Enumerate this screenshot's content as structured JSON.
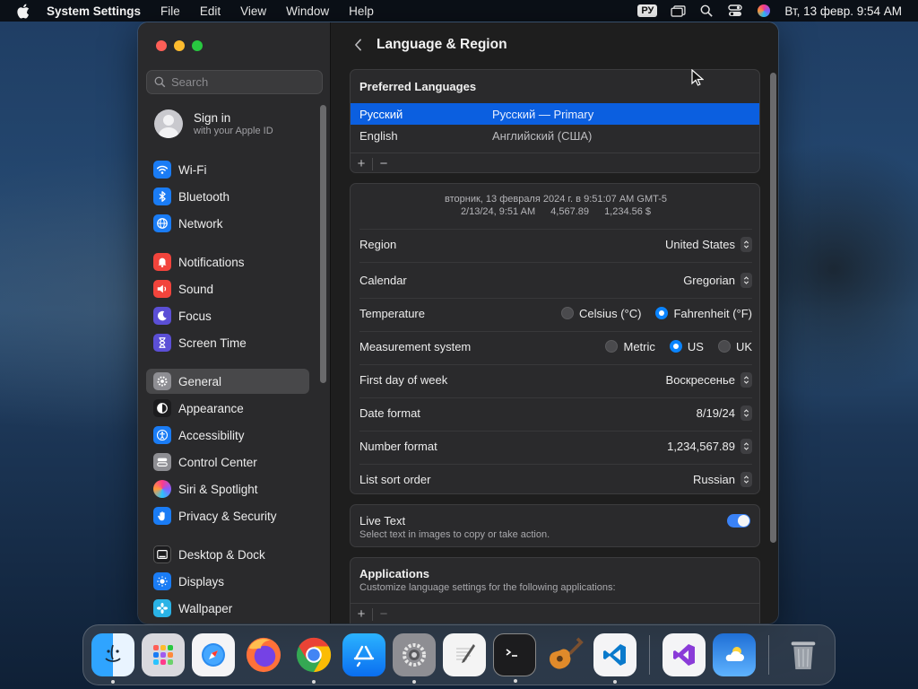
{
  "menubar": {
    "app_name": "System Settings",
    "menus": [
      "File",
      "Edit",
      "View",
      "Window",
      "Help"
    ],
    "input_lang": "РУ",
    "datetime": "Вт, 13 февр.  9:54 AM"
  },
  "sidebar": {
    "search_placeholder": "Search",
    "account": {
      "title": "Sign in",
      "subtitle": "with your Apple ID"
    },
    "items": [
      {
        "label": "Wi-Fi",
        "icon": "wifi-icon",
        "color": "#1a7cf5"
      },
      {
        "label": "Bluetooth",
        "icon": "bluetooth-icon",
        "color": "#1a7cf5"
      },
      {
        "label": "Network",
        "icon": "globe-icon",
        "color": "#1a7cf5"
      },
      {
        "label": "Notifications",
        "icon": "bell-icon",
        "color": "#f2443c"
      },
      {
        "label": "Sound",
        "icon": "speaker-icon",
        "color": "#f2443c"
      },
      {
        "label": "Focus",
        "icon": "moon-icon",
        "color": "#5b4fd6"
      },
      {
        "label": "Screen Time",
        "icon": "hourglass-icon",
        "color": "#5b4fd6"
      },
      {
        "label": "General",
        "icon": "gear-icon",
        "color": "#8e8e93"
      },
      {
        "label": "Appearance",
        "icon": "appearance-icon",
        "color": "#1c1c1e"
      },
      {
        "label": "Accessibility",
        "icon": "accessibility-icon",
        "color": "#1a7cf5"
      },
      {
        "label": "Control Center",
        "icon": "control-center-icon",
        "color": "#8e8e93"
      },
      {
        "label": "Siri & Spotlight",
        "icon": "siri-icon",
        "color": "#7a4fd6"
      },
      {
        "label": "Privacy & Security",
        "icon": "hand-icon",
        "color": "#1a7cf5"
      },
      {
        "label": "Desktop & Dock",
        "icon": "dock-icon",
        "color": "#1c1c1e"
      },
      {
        "label": "Displays",
        "icon": "sun-icon",
        "color": "#1a7cf5"
      },
      {
        "label": "Wallpaper",
        "icon": "flower-icon",
        "color": "#2ab3e6"
      }
    ],
    "selected": "General"
  },
  "content": {
    "title": "Language & Region",
    "preferred_languages": {
      "title": "Preferred Languages",
      "rows": [
        {
          "name": "Русский",
          "detail": "Русский — Primary"
        },
        {
          "name": "English",
          "detail": "Английский (США)"
        }
      ]
    },
    "preview": {
      "line1": "вторник, 13 февраля 2024 г. в 9:51:07 AM GMT-5",
      "line2": [
        "2/13/24, 9:51 AM",
        "4,567.89",
        "1,234.56 $"
      ]
    },
    "settings": {
      "region": {
        "label": "Region",
        "value": "United States"
      },
      "calendar": {
        "label": "Calendar",
        "value": "Gregorian"
      },
      "temperature": {
        "label": "Temperature",
        "options": [
          "Celsius (°C)",
          "Fahrenheit (°F)"
        ]
      },
      "measurement": {
        "label": "Measurement system",
        "options": [
          "Metric",
          "US",
          "UK"
        ]
      },
      "first_day": {
        "label": "First day of week",
        "value": "Воскресенье"
      },
      "date_format": {
        "label": "Date format",
        "value": "8/19/24"
      },
      "number_format": {
        "label": "Number format",
        "value": "1,234,567.89"
      },
      "sort_order": {
        "label": "List sort order",
        "value": "Russian"
      }
    },
    "live_text": {
      "title": "Live Text",
      "subtitle": "Select text in images to copy or take action."
    },
    "applications": {
      "title": "Applications",
      "subtitle": "Customize language settings for the following applications:"
    }
  },
  "dock": [
    "Finder",
    "Launchpad",
    "Safari",
    "Firefox",
    "Chrome",
    "App Store",
    "System Settings",
    "TextEdit",
    "Terminal",
    "GarageBand",
    "Visual Studio Code",
    "Visual Studio",
    "Weather",
    "Trash"
  ]
}
